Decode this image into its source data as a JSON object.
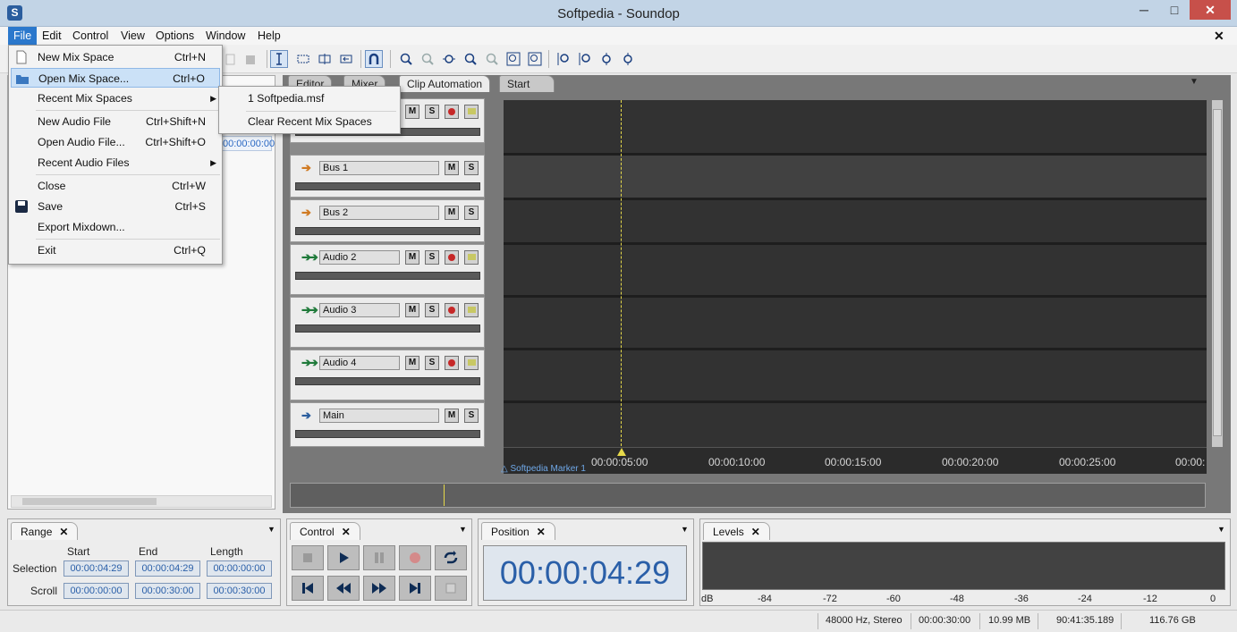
{
  "window": {
    "title": "Softpedia - Soundop",
    "app_icon": "S",
    "controls": [
      "─",
      "□",
      "✕"
    ]
  },
  "menubar": {
    "items": [
      "File",
      "Edit",
      "Control",
      "View",
      "Options",
      "Window",
      "Help"
    ],
    "doc_close": "✕"
  },
  "file_menu": {
    "items": [
      {
        "label": "New Mix Space",
        "shortcut": "Ctrl+N"
      },
      {
        "label": "Open Mix Space...",
        "shortcut": "Ctrl+O"
      },
      {
        "label": "Recent Mix Spaces",
        "shortcut": ""
      },
      {
        "label": "New Audio File",
        "shortcut": "Ctrl+Shift+N"
      },
      {
        "label": "Open Audio File...",
        "shortcut": "Ctrl+Shift+O"
      },
      {
        "label": "Recent Audio Files",
        "shortcut": ""
      },
      {
        "label": "Close",
        "shortcut": "Ctrl+W"
      },
      {
        "label": "Save",
        "shortcut": "Ctrl+S"
      },
      {
        "label": "Export Mixdown...",
        "shortcut": ""
      },
      {
        "label": "Exit",
        "shortcut": "Ctrl+Q"
      }
    ]
  },
  "recent_submenu": {
    "items": [
      "1 Softpedia.msf",
      "Clear Recent Mix Spaces"
    ]
  },
  "tabs": [
    "Editor",
    "Mixer",
    "Clip Automation",
    "Start"
  ],
  "left_panel": {
    "timestamp": "00:00:00:00"
  },
  "tracks": [
    {
      "name": "",
      "type": "audio"
    },
    {
      "name": "Bus 1",
      "type": "bus"
    },
    {
      "name": "Bus 2",
      "type": "bus"
    },
    {
      "name": "Audio 2",
      "type": "audio"
    },
    {
      "name": "Audio 3",
      "type": "audio"
    },
    {
      "name": "Audio 4",
      "type": "audio"
    },
    {
      "name": "Main",
      "type": "main"
    }
  ],
  "track_buttons": {
    "mute": "M",
    "solo": "S"
  },
  "ruler": {
    "labels": [
      "00:00:05:00",
      "00:00:10:00",
      "00:00:15:00",
      "00:00:20:00",
      "00:00:25:00",
      "00:00:"
    ],
    "marker": "Softpedia Marker 1"
  },
  "range_panel": {
    "title": "Range",
    "col_headers": [
      "Start",
      "End",
      "Length"
    ],
    "rows": [
      {
        "label": "Selection",
        "values": [
          "00:00:04:29",
          "00:00:04:29",
          "00:00:00:00"
        ]
      },
      {
        "label": "Scroll",
        "values": [
          "00:00:00:00",
          "00:00:30:00",
          "00:00:30:00"
        ]
      }
    ]
  },
  "control_panel": {
    "title": "Control"
  },
  "position_panel": {
    "title": "Position",
    "time": "00:00:04:29"
  },
  "levels_panel": {
    "title": "Levels",
    "scale": [
      "dB",
      "-84",
      "-72",
      "-60",
      "-48",
      "-36",
      "-24",
      "-12",
      "0"
    ]
  },
  "status": {
    "format": "48000 Hz, Stereo",
    "duration": "00:00:30:00",
    "size": "10.99 MB",
    "free_time": "90:41:35.189",
    "free_space": "116.76 GB"
  }
}
